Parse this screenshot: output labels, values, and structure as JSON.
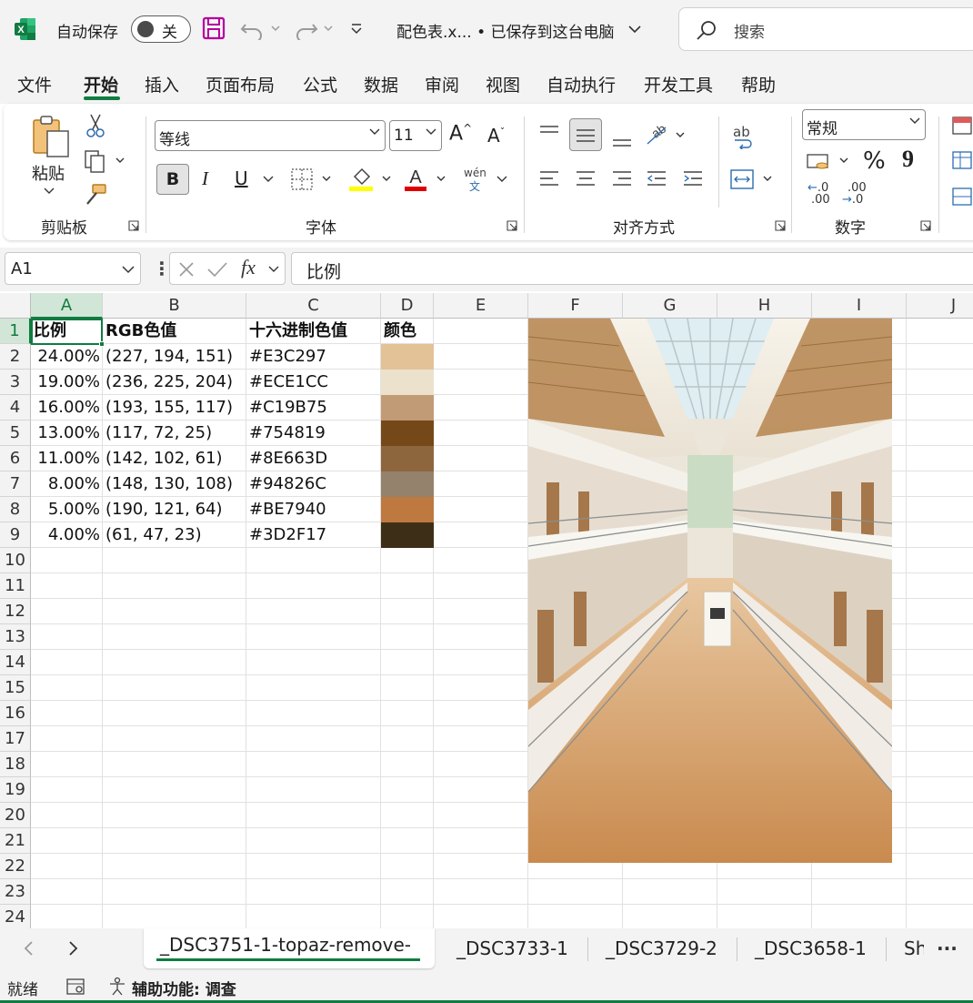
{
  "titlebar": {
    "autosave_label": "自动保存",
    "autosave_state": "关",
    "doc_title": "配色表.x... • 已保存到这台电脑",
    "search_placeholder": "搜索"
  },
  "menu": {
    "items": [
      "文件",
      "开始",
      "插入",
      "页面布局",
      "公式",
      "数据",
      "审阅",
      "视图",
      "自动执行",
      "开发工具",
      "帮助"
    ],
    "active": "开始"
  },
  "ribbon": {
    "clipboard": {
      "paste_label": "粘贴",
      "group_label": "剪贴板"
    },
    "font": {
      "font_name": "等线",
      "font_size": "11",
      "group_label": "字体",
      "bold": "B",
      "italic": "I",
      "underline": "U",
      "phonetic_top": "wén",
      "phonetic_bottom": "文",
      "grow": "A",
      "shrink": "A"
    },
    "alignment": {
      "group_label": "对齐方式",
      "wrap_label": "ab"
    },
    "number": {
      "format": "常规",
      "percent": "%",
      "comma": "9",
      "inc_decimal": ".0",
      "dec_decimal": ".00",
      "group_label": "数字"
    }
  },
  "formula_bar": {
    "name_box": "A1",
    "fx": "fx",
    "value": "比例"
  },
  "grid": {
    "columns": [
      "A",
      "B",
      "C",
      "D",
      "E",
      "F",
      "G",
      "H",
      "I",
      "J"
    ],
    "rows": [
      "1",
      "2",
      "3",
      "4",
      "5",
      "6",
      "7",
      "8",
      "9",
      "10",
      "11",
      "12",
      "13",
      "14",
      "15",
      "16",
      "17",
      "18",
      "19",
      "20",
      "21",
      "22",
      "23",
      "24"
    ],
    "header": [
      "比例",
      "RGB色值",
      "十六进制色值",
      "颜色"
    ],
    "data": [
      {
        "ratio": "24.00%",
        "rgb": "(227, 194, 151)",
        "hex": "#E3C297",
        "color": "#E3C297"
      },
      {
        "ratio": "19.00%",
        "rgb": "(236, 225, 204)",
        "hex": "#ECE1CC",
        "color": "#ECE1CC"
      },
      {
        "ratio": "16.00%",
        "rgb": "(193, 155, 117)",
        "hex": "#C19B75",
        "color": "#C19B75"
      },
      {
        "ratio": "13.00%",
        "rgb": "(117, 72, 25)",
        "hex": "#754819",
        "color": "#754819"
      },
      {
        "ratio": "11.00%",
        "rgb": "(142, 102, 61)",
        "hex": "#8E663D",
        "color": "#8E663D"
      },
      {
        "ratio": "8.00%",
        "rgb": "(148, 130, 108)",
        "hex": "#94826C",
        "color": "#94826C"
      },
      {
        "ratio": "5.00%",
        "rgb": "(190, 121, 64)",
        "hex": "#BE7940",
        "color": "#BE7940"
      },
      {
        "ratio": "4.00%",
        "rgb": "(61, 47, 23)",
        "hex": "#3D2F17",
        "color": "#3D2F17"
      }
    ]
  },
  "sheet_tabs": {
    "active": "_DSC3751-1-topaz-remove-",
    "others": [
      "_DSC3733-1",
      "_DSC3729-2",
      "_DSC3658-1",
      "Sh"
    ]
  },
  "status": {
    "ready": "就绪",
    "accessibility": "辅助功能: 调查"
  },
  "colors": {
    "accent": "#107c41",
    "save_icon": "#b4009e"
  }
}
